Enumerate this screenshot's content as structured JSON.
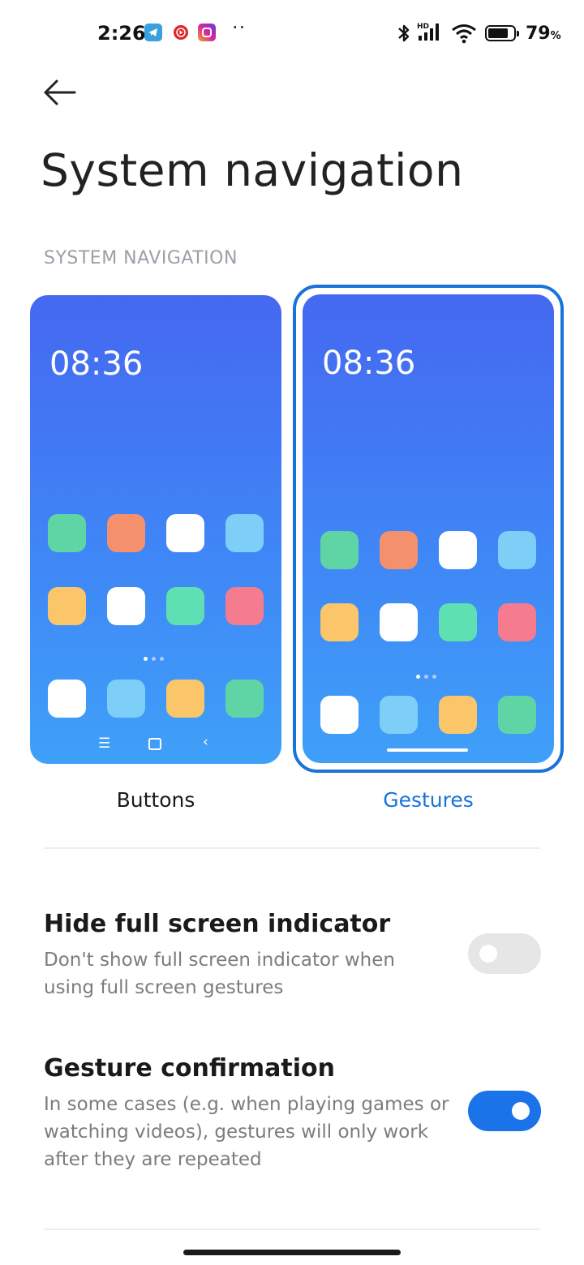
{
  "status_bar": {
    "time": "2:26",
    "notification_icons": [
      "telegram-icon",
      "youtube-music-icon",
      "instagram-icon"
    ],
    "more_notifications": "··",
    "network_label": "HD",
    "battery_percent": "79",
    "battery_unit": "%",
    "battery_level": 0.79
  },
  "header": {
    "back_icon": "arrow-left-icon",
    "title": "System navigation"
  },
  "section_label": "SYSTEM NAVIGATION",
  "navigation_options": {
    "buttons": {
      "label": "Buttons",
      "clock": "08:36",
      "selected": false,
      "nav_icons": [
        "menu-icon",
        "home-square-icon",
        "back-chevron-icon"
      ]
    },
    "gestures": {
      "label": "Gestures",
      "clock": "08:36",
      "selected": true
    },
    "app_tile_colors": {
      "row1": [
        "#5fd5a6",
        "#f5906d",
        "#ffffff",
        "#7dcff8"
      ],
      "row2": [
        "#fbc66a",
        "#ffffff",
        "#5fe0b2",
        "#f57b8f"
      ],
      "dock": [
        "#ffffff",
        "#7dcff8",
        "#fbc66a",
        "#5fd5a6"
      ]
    },
    "accent_color": "#1a73d9"
  },
  "settings": {
    "hide_indicator": {
      "title": "Hide full screen indicator",
      "description": "Don't show full screen indicator when using full screen gestures",
      "enabled": false
    },
    "gesture_confirmation": {
      "title": "Gesture confirmation",
      "description": "In some cases (e.g. when playing games or watching videos), gestures will only work after they are repeated",
      "enabled": true
    }
  }
}
